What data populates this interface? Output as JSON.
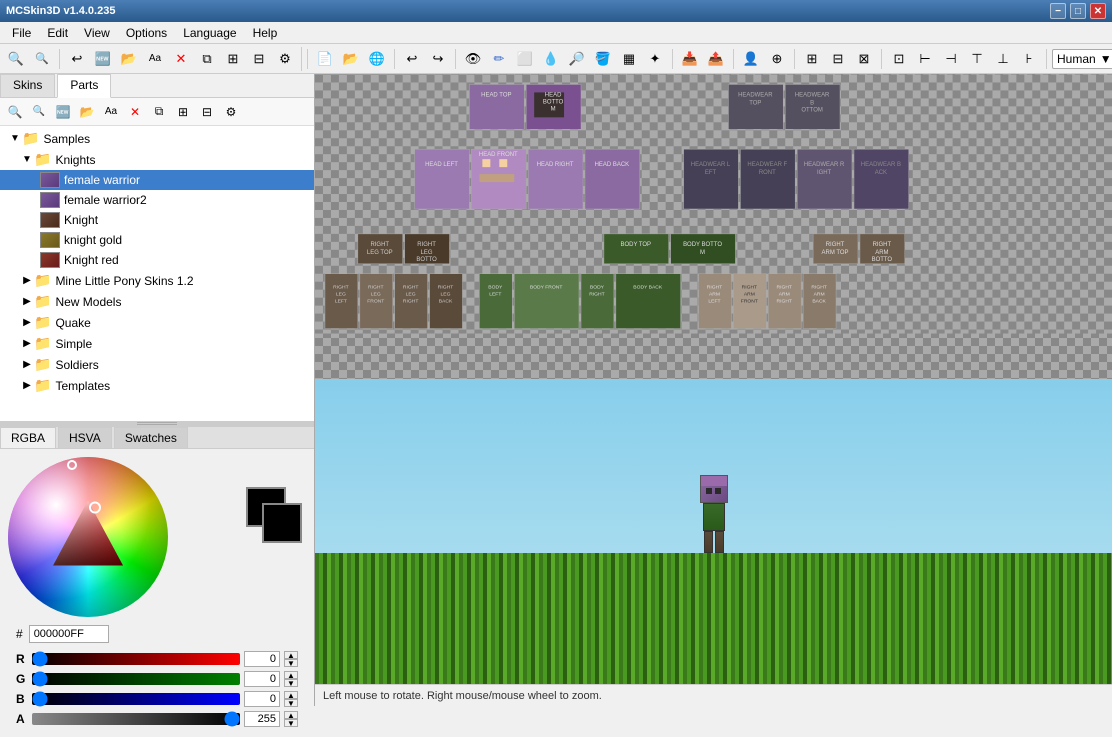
{
  "titlebar": {
    "title": "MCSkin3D v1.4.0.235",
    "min": "−",
    "max": "□",
    "close": "✕"
  },
  "menubar": {
    "items": [
      "File",
      "Edit",
      "View",
      "Options",
      "Language",
      "Help"
    ]
  },
  "toolbar": {
    "buttons": [
      {
        "name": "zoom-in",
        "icon": "🔍",
        "label": "Zoom In"
      },
      {
        "name": "zoom-out",
        "icon": "🔍",
        "label": "Zoom Out"
      },
      {
        "name": "undo",
        "icon": "↩",
        "label": "Undo"
      },
      {
        "name": "redo",
        "icon": "↪",
        "label": "Redo"
      },
      {
        "name": "eye",
        "icon": "👁",
        "label": "View"
      },
      {
        "name": "pencil",
        "icon": "✏",
        "label": "Pencil"
      },
      {
        "name": "eraser",
        "icon": "⬜",
        "label": "Eraser"
      },
      {
        "name": "dropper",
        "icon": "💧",
        "label": "Dropper"
      },
      {
        "name": "magnify",
        "icon": "🔎",
        "label": "Magnify"
      },
      {
        "name": "fill",
        "icon": "🪣",
        "label": "Fill"
      },
      {
        "name": "noise",
        "icon": "▦",
        "label": "Noise"
      },
      {
        "name": "import",
        "icon": "📥",
        "label": "Import"
      },
      {
        "name": "export",
        "icon": "📤",
        "label": "Export"
      },
      {
        "name": "morph",
        "icon": "👤",
        "label": "Morph"
      },
      {
        "name": "tool1",
        "icon": "⊕",
        "label": "Tool1"
      },
      {
        "name": "tool2",
        "icon": "⊞",
        "label": "Tool2"
      },
      {
        "name": "tool3",
        "icon": "⊟",
        "label": "Tool3"
      },
      {
        "name": "tool4",
        "icon": "⊠",
        "label": "Tool4"
      },
      {
        "name": "tool5",
        "icon": "⊡",
        "label": "Tool5"
      },
      {
        "name": "tool6",
        "icon": "⊢",
        "label": "Tool6"
      },
      {
        "name": "tool7",
        "icon": "⊣",
        "label": "Tool7"
      },
      {
        "name": "tool8",
        "icon": "⊤",
        "label": "Tool8"
      }
    ],
    "model_dropdown": "Human",
    "nav_icon": "▶"
  },
  "panels": {
    "left_tabs": [
      "Skins",
      "Parts"
    ],
    "active_left_tab": "Parts"
  },
  "tree": {
    "nodes": [
      {
        "id": "samples",
        "label": "Samples",
        "level": 0,
        "type": "folder",
        "expanded": true
      },
      {
        "id": "knights",
        "label": "Knights",
        "level": 1,
        "type": "folder",
        "expanded": true
      },
      {
        "id": "female-warrior",
        "label": "female warrior",
        "level": 2,
        "type": "skin",
        "selected": true,
        "color": "#6a4a8a"
      },
      {
        "id": "female-warrior2",
        "label": "female warrior2",
        "level": 2,
        "type": "skin",
        "color": "#6a4a8a"
      },
      {
        "id": "knight",
        "label": "Knight",
        "level": 2,
        "type": "skin",
        "color": "#5a3a2a"
      },
      {
        "id": "knight-gold",
        "label": "knight gold",
        "level": 2,
        "type": "skin",
        "color": "#6a5a1a"
      },
      {
        "id": "knight-red",
        "label": "Knight red",
        "level": 2,
        "type": "skin",
        "color": "#6a2a1a"
      },
      {
        "id": "mine-little-pony",
        "label": "Mine Little Pony Skins 1.2",
        "level": 1,
        "type": "folder",
        "expanded": false
      },
      {
        "id": "new-models",
        "label": "New Models",
        "level": 1,
        "type": "folder",
        "expanded": false
      },
      {
        "id": "quake",
        "label": "Quake",
        "level": 1,
        "type": "folder",
        "expanded": false
      },
      {
        "id": "simple",
        "label": "Simple",
        "level": 1,
        "type": "folder",
        "expanded": false
      },
      {
        "id": "soldiers",
        "label": "Soldiers",
        "level": 1,
        "type": "folder",
        "expanded": false
      },
      {
        "id": "templates",
        "label": "Templates",
        "level": 1,
        "type": "folder",
        "expanded": false
      }
    ]
  },
  "color_panel": {
    "tabs": [
      "RGBA",
      "HSVA",
      "Swatches"
    ],
    "active_tab": "RGBA",
    "hex_value": "000000FF",
    "channels": {
      "r": {
        "label": "R",
        "value": 0,
        "max": 255
      },
      "g": {
        "label": "G",
        "value": 0,
        "max": 255
      },
      "b": {
        "label": "B",
        "value": 0,
        "max": 255
      },
      "a": {
        "label": "A",
        "value": 255,
        "max": 255
      }
    }
  },
  "skin_parts": {
    "labels": [
      "HEAD TOP",
      "HEAD BOTTO M",
      "",
      "",
      "HEADWEAR TOP",
      "HEADWEAR B OTTOM",
      "HEAD LEFT",
      "HEAD FRONT",
      "HEAD RIGHT",
      "HEAD BACK",
      "HEADWEAR L EFT",
      "HEADWEAR F RONT",
      "HEADWEAR R IGHT",
      "HEADWEAR B ACK",
      "RIGHT LEG TOP",
      "RIGHT LEG BOTTO",
      "",
      "BODY TOP",
      "BODY BOTTO M",
      "",
      "RIGHT ARM TOP",
      "RIGHT LEG LEFT",
      "RIGHT LEG FRONT",
      "RIGHT LEG RIGHT",
      "RIGHT LEG BACK",
      "BODY LEFT",
      "BODY FRONT",
      "BODY RIGHT",
      "BODY BACK",
      "RIGHT ARM LEFT",
      "RIGHT ARM FRONT",
      "RIGHT ARM RIGHT",
      "RIGHT ARM BACK"
    ]
  },
  "status_bar": {
    "message": "Left mouse to rotate. Right mouse/mouse wheel to zoom."
  }
}
